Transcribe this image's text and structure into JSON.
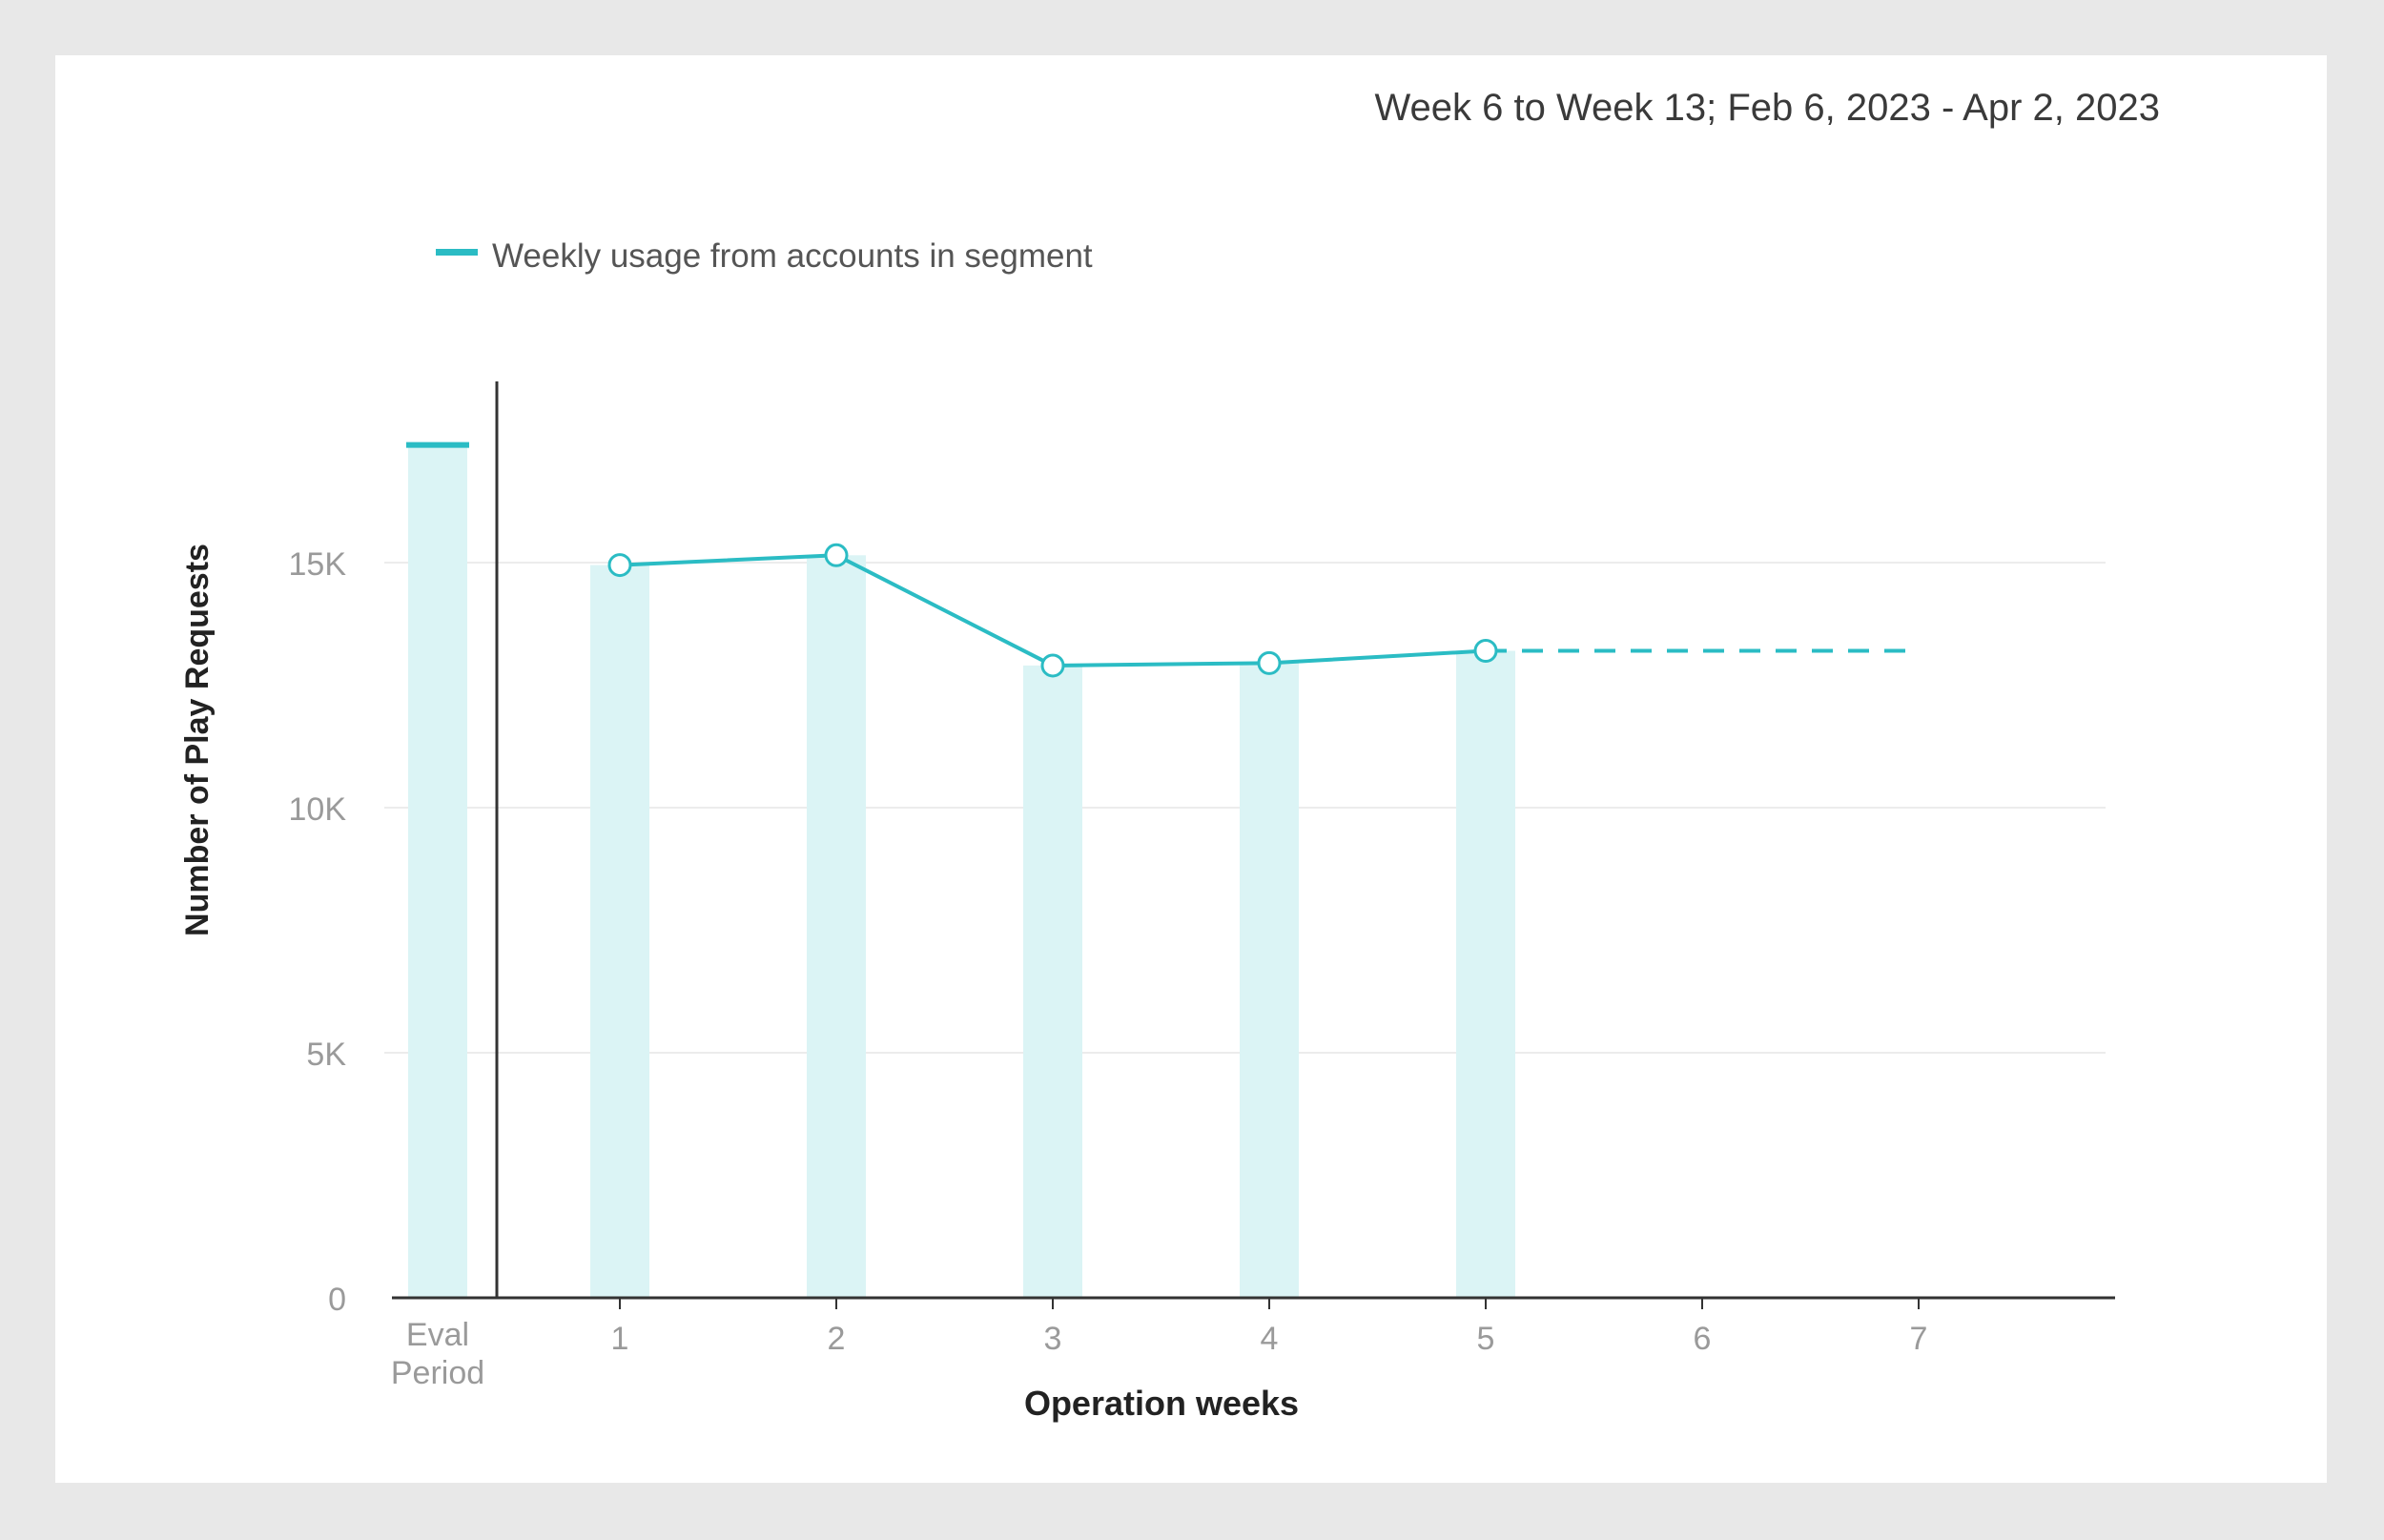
{
  "header": {
    "date_range": "Week 6 to Week 13; Feb 6, 2023 - Apr 2, 2023"
  },
  "colors": {
    "accent": "#2bbcc4",
    "bar_fill": "#dbf4f5",
    "gridline": "#ececec",
    "axis": "#333333",
    "tick_text": "#9a9a9a",
    "title_text": "#3a3a3a"
  },
  "chart_data": {
    "type": "line",
    "title": "",
    "xlabel": "Operation weeks",
    "ylabel": "Number of Play Requests",
    "ylim": [
      0,
      18000
    ],
    "y_ticks": [
      {
        "value": 0,
        "label": "0"
      },
      {
        "value": 5000,
        "label": "5K"
      },
      {
        "value": 10000,
        "label": "10K"
      },
      {
        "value": 15000,
        "label": "15K"
      }
    ],
    "grid": true,
    "legend": "top-left",
    "eval_period": {
      "label_lines": [
        "Eval",
        "Period"
      ],
      "value": 17400
    },
    "categories": [
      "1",
      "2",
      "3",
      "4",
      "5",
      "6",
      "7"
    ],
    "series": [
      {
        "name": "Weekly usage from accounts in segment",
        "values": [
          14950,
          15150,
          12900,
          12950,
          13200,
          null,
          null
        ]
      }
    ],
    "projection": {
      "from_week": 5,
      "to_week": 7,
      "value": 13200
    }
  }
}
